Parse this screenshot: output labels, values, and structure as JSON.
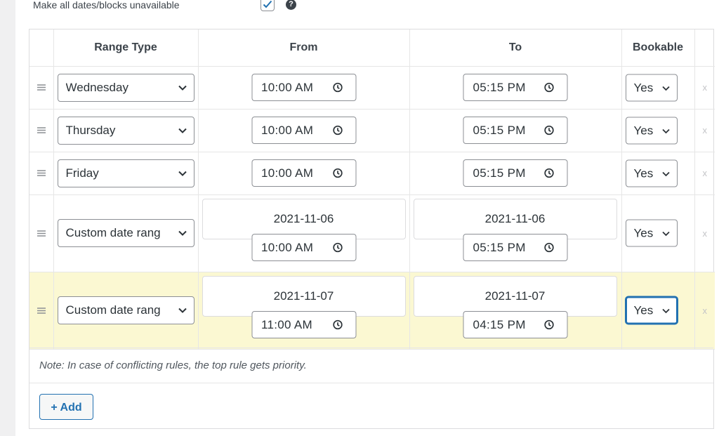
{
  "option": {
    "label": "Make all dates/blocks unavailable",
    "checked": true,
    "help_icon": "question-circle-icon"
  },
  "table": {
    "headers": [
      "Range Type",
      "From",
      "To",
      "Bookable"
    ],
    "rows": [
      {
        "range_type": "Wednesday",
        "from_time": "10:00 AM",
        "to_time": "05:15 PM",
        "bookable": "Yes"
      },
      {
        "range_type": "Thursday",
        "from_time": "10:00 AM",
        "to_time": "05:15 PM",
        "bookable": "Yes"
      },
      {
        "range_type": "Friday",
        "from_time": "10:00 AM",
        "to_time": "05:15 PM",
        "bookable": "Yes"
      },
      {
        "range_type": "Custom date rang",
        "from_date": "2021-11-06",
        "from_time": "10:00 AM",
        "to_date": "2021-11-06",
        "to_time": "05:15 PM",
        "bookable": "Yes"
      },
      {
        "range_type": "Custom date rang",
        "from_date": "2021-11-07",
        "from_time": "11:00 AM",
        "to_date": "2021-11-07",
        "to_time": "04:15 PM",
        "bookable": "Yes"
      }
    ],
    "remove_label": "x",
    "highlight_color": "#fbf8d2"
  },
  "note": "Note: In case of conflicting rules, the top rule gets priority.",
  "add_button_label": "+ Add",
  "colors": {
    "accent": "#2271b1",
    "border": "#8c8f94",
    "highlight": "#fbf8d2"
  }
}
